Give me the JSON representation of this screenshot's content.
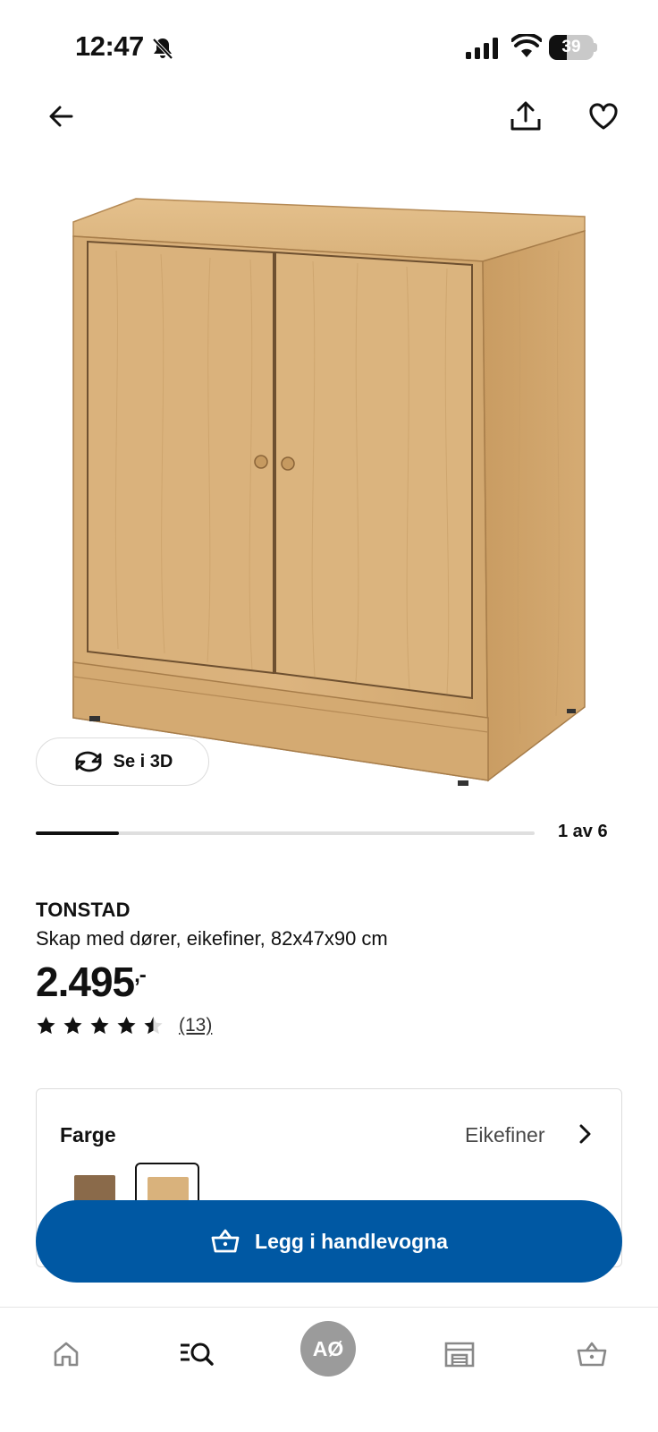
{
  "status_bar": {
    "time": "12:47",
    "battery_level": "39",
    "battery_fraction": 0.39
  },
  "product": {
    "name": "TONSTAD",
    "description": "Skap med dører, eikefiner, 82x47x90 cm",
    "price": "2.495",
    "price_suffix": ",-",
    "rating": 4.5,
    "review_count": "(13)"
  },
  "image": {
    "view_3d_label": "Se i 3D",
    "page_indicator": "1 av 6",
    "progress_fraction": 0.1667
  },
  "variant": {
    "label": "Farge",
    "selected_value": "Eikefiner",
    "swatches": [
      {
        "name": "brown-stained-ash",
        "color": "#8a6a4a"
      },
      {
        "name": "oak-veneer",
        "color": "#d9b27c",
        "selected": true
      }
    ]
  },
  "cta": {
    "add_to_cart_label": "Legg i handlevogna",
    "color": "#0058a3"
  },
  "bottom_nav": {
    "avatar_initials": "AØ",
    "items": [
      "home-icon",
      "search-icon",
      "avatar",
      "store-icon",
      "cart-icon"
    ]
  },
  "colors": {
    "wood": "#d4aa72",
    "wood_dark": "#b8874f",
    "accent": "#0058a3"
  }
}
